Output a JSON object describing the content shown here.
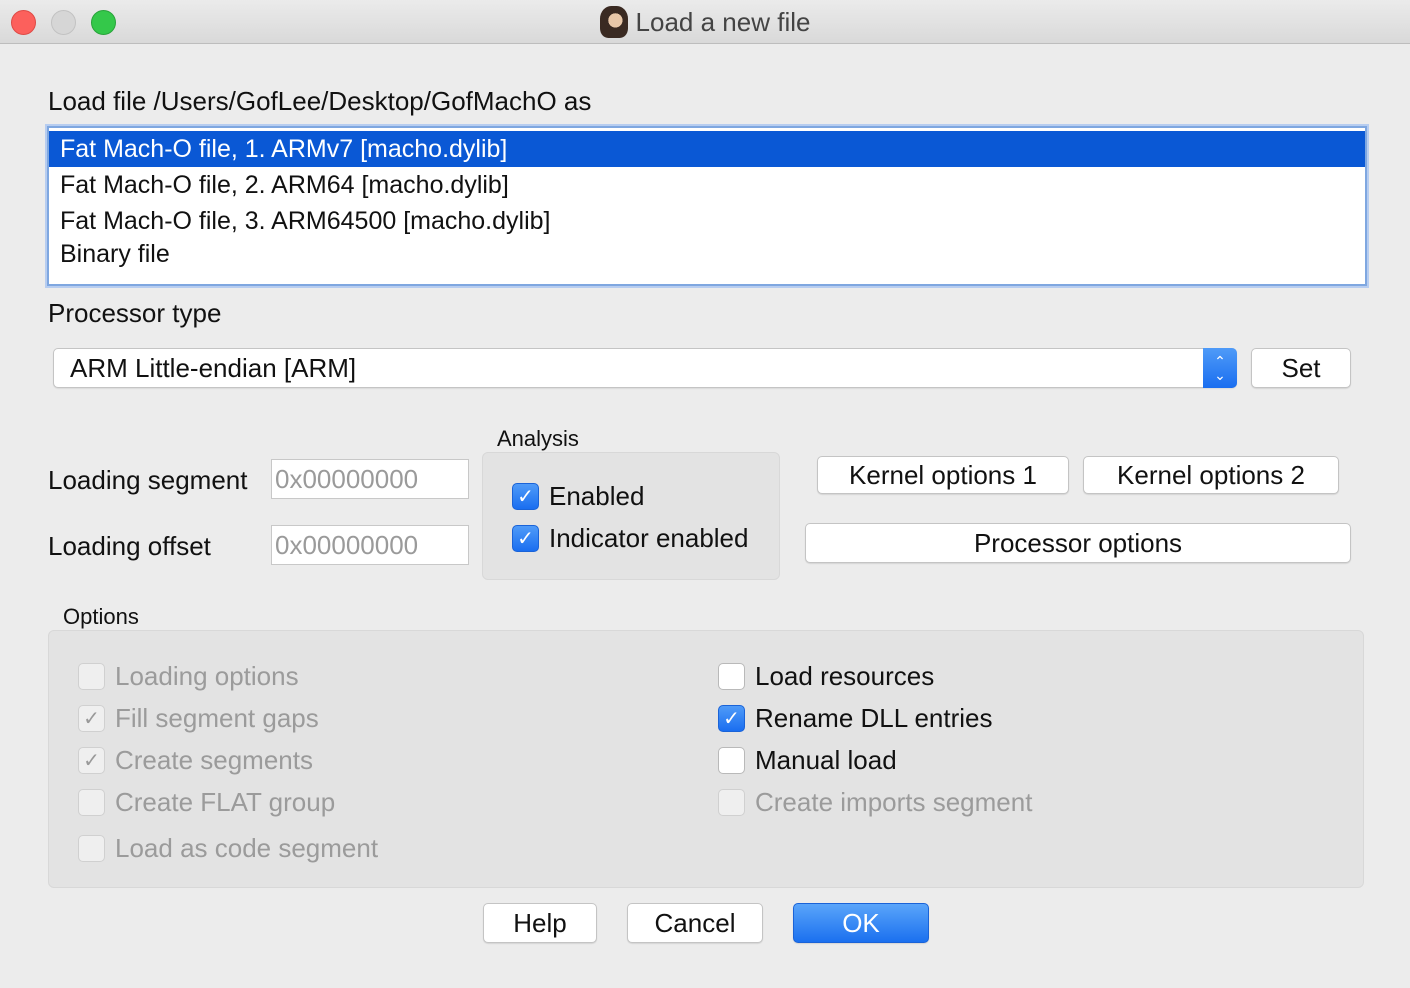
{
  "window": {
    "title": "Load a new file"
  },
  "load_file": {
    "label": "Load file /Users/GofLee/Desktop/GofMachO as",
    "items": [
      "Fat Mach-O file, 1. ARMv7 [macho.dylib]",
      "Fat Mach-O file, 2. ARM64 [macho.dylib]",
      "Fat Mach-O file, 3. ARM64500 [macho.dylib]",
      "Binary file"
    ],
    "selected_index": 0
  },
  "processor": {
    "label": "Processor type",
    "selected": "ARM Little-endian [ARM]",
    "set_label": "Set"
  },
  "loading": {
    "segment_label": "Loading segment",
    "segment_value": "0x00000000",
    "offset_label": "Loading offset",
    "offset_value": "0x00000000"
  },
  "analysis": {
    "title": "Analysis",
    "enabled_label": "Enabled",
    "enabled_checked": true,
    "indicator_label": "Indicator enabled",
    "indicator_checked": true
  },
  "right_buttons": {
    "kernel1": "Kernel options 1",
    "kernel2": "Kernel options 2",
    "processor_options": "Processor options"
  },
  "options": {
    "title": "Options",
    "left": [
      {
        "label": "Loading options",
        "checked": false,
        "enabled": false
      },
      {
        "label": "Fill segment gaps",
        "checked": true,
        "enabled": false
      },
      {
        "label": "Create segments",
        "checked": true,
        "enabled": false
      },
      {
        "label": "Create FLAT group",
        "checked": false,
        "enabled": false
      },
      {
        "label": "Load as code segment",
        "checked": false,
        "enabled": false
      }
    ],
    "right": [
      {
        "label": "Load resources",
        "checked": false,
        "enabled": true
      },
      {
        "label": "Rename DLL entries",
        "checked": true,
        "enabled": true
      },
      {
        "label": "Manual load",
        "checked": false,
        "enabled": true
      },
      {
        "label": "Create imports segment",
        "checked": false,
        "enabled": false
      }
    ]
  },
  "footer": {
    "help": "Help",
    "cancel": "Cancel",
    "ok": "OK"
  },
  "icons": {
    "check": "✓",
    "chevrons": [
      "⌃",
      "⌄"
    ]
  },
  "colors": {
    "accent": "#1a6ef0",
    "selection": "#0a58d5"
  }
}
